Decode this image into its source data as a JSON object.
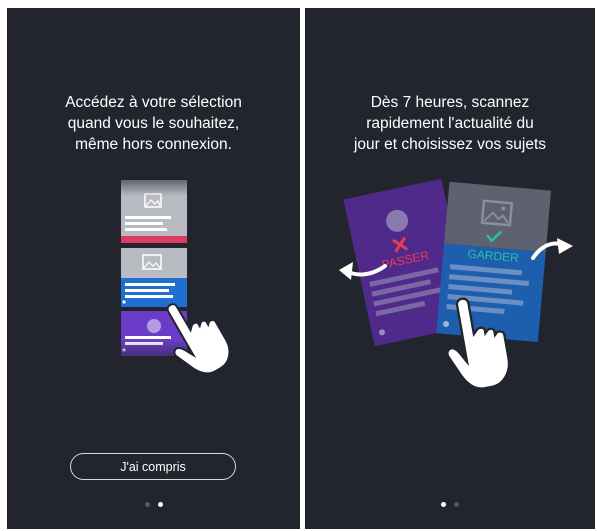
{
  "screen1": {
    "headline": [
      "Accédez à votre sélection",
      "quand vous le souhaitez,",
      "même hors connexion."
    ],
    "button_label": "J'ai compris",
    "pagination": {
      "total": 2,
      "active": 2
    }
  },
  "screen2": {
    "headline": [
      "Dès 7 heures, scannez",
      "rapidement l'actualité du",
      "jour et choisissez vos sujets"
    ],
    "card_left_label": "PASSER",
    "card_right_label": "GARDER",
    "pagination": {
      "total": 2,
      "active": 1
    }
  },
  "colors": {
    "background": "#23252e",
    "passer": "#e8395a",
    "garder": "#2bbfa6",
    "card_purple": "#4f2a8a",
    "card_blue": "#1d5fae",
    "strip_pink": "#e03b63",
    "strip_blue": "#1e6fd0"
  },
  "icons": [
    "image-placeholder-icon",
    "hand-pointer-icon",
    "swipe-left-arrow-icon",
    "swipe-right-arrow-icon",
    "cross-icon",
    "check-icon"
  ]
}
